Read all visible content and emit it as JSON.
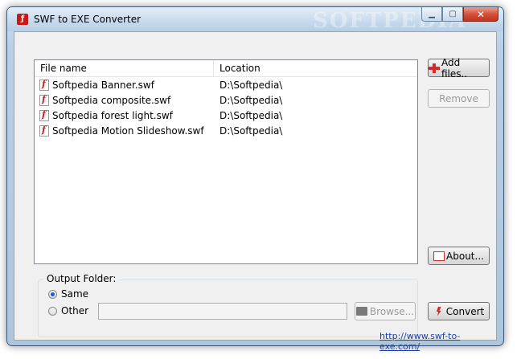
{
  "window": {
    "title": "SWF to EXE Converter",
    "watermark": "SOFTPEDIA",
    "minimize_glyph": "▁",
    "maximize_glyph": "▢",
    "close_glyph": "✕"
  },
  "file_list": {
    "columns": [
      "File name",
      "Location"
    ],
    "rows": [
      {
        "name": "Softpedia Banner.swf",
        "location": "D:\\Softpedia\\"
      },
      {
        "name": "Softpedia composite.swf",
        "location": "D:\\Softpedia\\"
      },
      {
        "name": "Softpedia forest light.swf",
        "location": "D:\\Softpedia\\"
      },
      {
        "name": "Softpedia Motion Slideshow.swf",
        "location": "D:\\Softpedia\\"
      }
    ]
  },
  "buttons": {
    "add_files": "Add files..",
    "remove": "Remove",
    "about": "About...",
    "convert": "Convert",
    "browse": "Browse..."
  },
  "output_folder": {
    "label": "Output Folder:",
    "same_label": "Same",
    "other_label": "Other",
    "path_value": "",
    "selected": "same"
  },
  "link": {
    "text": "http://www.swf-to-exe.com/"
  },
  "colors": {
    "accent_red": "#c91818",
    "link_blue": "#1c3fa8",
    "radio_blue": "#1a5ec9"
  }
}
